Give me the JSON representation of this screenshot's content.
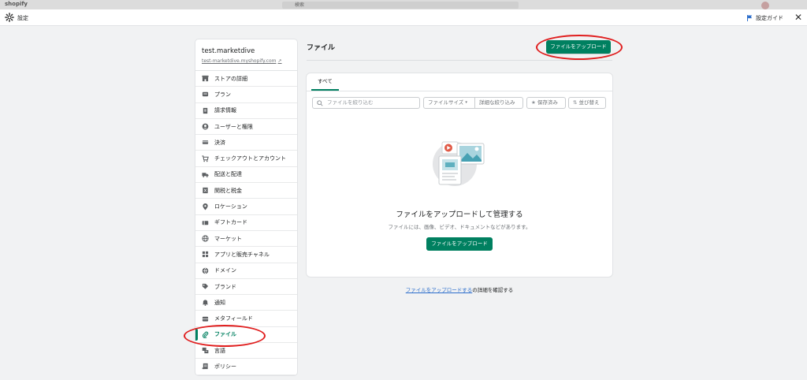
{
  "topbar": {
    "logo_text": "shopify",
    "search_placeholder": "検索"
  },
  "settings_bar": {
    "title": "設定",
    "guide_label": "設定ガイド",
    "close_symbol": "✕"
  },
  "store": {
    "name": "test.marketdive",
    "url": "test-marketdive.myshopify.com"
  },
  "sidebar": {
    "items": [
      {
        "label": "ストアの詳細",
        "icon": "store-icon"
      },
      {
        "label": "プラン",
        "icon": "plan-icon"
      },
      {
        "label": "請求情報",
        "icon": "billing-icon"
      },
      {
        "label": "ユーザーと権限",
        "icon": "user-icon"
      },
      {
        "label": "決済",
        "icon": "payment-icon"
      },
      {
        "label": "チェックアウトとアカウント",
        "icon": "cart-icon"
      },
      {
        "label": "配送と配達",
        "icon": "truck-icon"
      },
      {
        "label": "関税と税金",
        "icon": "tax-icon"
      },
      {
        "label": "ロケーション",
        "icon": "location-icon"
      },
      {
        "label": "ギフトカード",
        "icon": "gift-card-icon"
      },
      {
        "label": "マーケット",
        "icon": "globe-icon"
      },
      {
        "label": "アプリと販売チャネル",
        "icon": "apps-icon"
      },
      {
        "label": "ドメイン",
        "icon": "domain-icon"
      },
      {
        "label": "ブランド",
        "icon": "brand-icon"
      },
      {
        "label": "通知",
        "icon": "bell-icon"
      },
      {
        "label": "メタフィールド",
        "icon": "metafield-icon"
      },
      {
        "label": "ファイル",
        "icon": "paperclip-icon",
        "active": true
      },
      {
        "label": "言語",
        "icon": "language-icon"
      },
      {
        "label": "ポリシー",
        "icon": "policy-icon"
      }
    ]
  },
  "main": {
    "title": "ファイル",
    "upload_button": "ファイルをアップロード",
    "tabs": [
      {
        "label": "すべて"
      }
    ],
    "filters": {
      "search_placeholder": "ファイルを絞り込む",
      "file_size": "ファイルサイズ",
      "more_filters": "詳細な絞り込み",
      "saved": "保存済み",
      "sort": "並び替え"
    },
    "empty_state": {
      "title": "ファイルをアップロードして管理する",
      "description": "ファイルには、画像、ビデオ、ドキュメントなどがあります。",
      "button": "ファイルをアップロード"
    },
    "learn_more": {
      "link_text": "ファイルをアップロードする",
      "suffix": "の詳細を確認する"
    }
  },
  "colors": {
    "primary": "#008060",
    "annotation": "#e01e1e",
    "link": "#2c6ecb"
  }
}
